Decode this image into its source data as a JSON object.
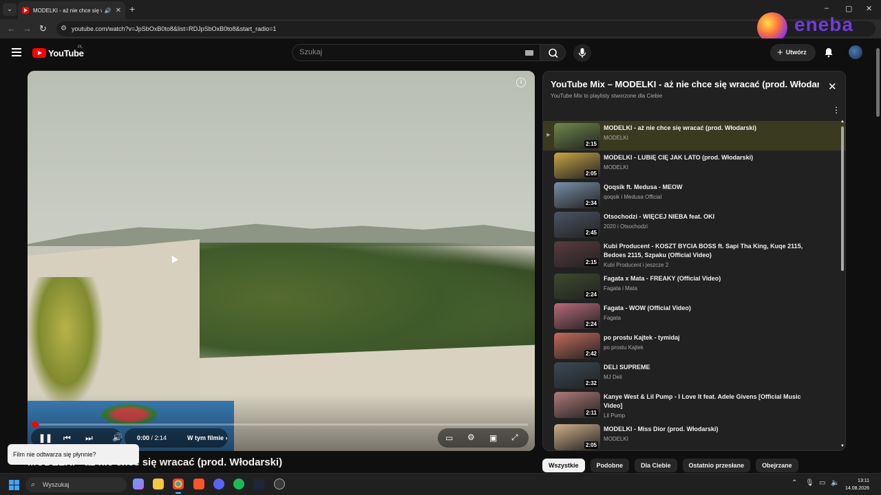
{
  "browser": {
    "tab_title": "MODELKI - aż nie chce się wracać",
    "url": "youtube.com/watch?v=JpSbOxB0to8&list=RDJpSbOxB0to8&start_radio=1",
    "new_tab": "+",
    "window_controls": [
      "–",
      "▢",
      "✕"
    ]
  },
  "watermark": {
    "text": "eneba"
  },
  "youtube": {
    "logo_text": "YouTube",
    "region": "PL",
    "search_placeholder": "Szukaj",
    "create_label": "Utwórz"
  },
  "player": {
    "time_current": "0:00",
    "time_sep": " / ",
    "time_total": "2:14",
    "chapter_label": "W tym filmie ›",
    "progress": 0.01
  },
  "toast": "Film nie odtwarza się płynnie?",
  "video_title": "MODELKI - aż nie chce się wracać (prod. Włodarski)",
  "playlist": {
    "title": "YouTube Mix – MODELKI - aż nie chce się wracać (prod. Włodar...",
    "subtitle": "YouTube Mix to playlisty stworzone dla Ciebie",
    "items": [
      {
        "title": "MODELKI - aż nie chce się wracać (prod. Włodarski)",
        "channel": "MODELKI",
        "duration": "2:15",
        "color": "#6f8a4b"
      },
      {
        "title": "MODELKI - LUBIĘ CIĘ JAK LATO (prod. Włodarski)",
        "channel": "MODELKI",
        "duration": "2:05",
        "color": "#c8a545"
      },
      {
        "title": "Qoqsik ft. Medusa - MEOW",
        "channel": "qoqsik i Medusa Official",
        "duration": "2:34",
        "color": "#7a8fa8"
      },
      {
        "title": "Otsochodzi - WIĘCEJ NIEBA feat. OKI",
        "channel": "2020 i Otsochodzi",
        "duration": "2:45",
        "color": "#4b5563"
      },
      {
        "title": "Kubi Producent - KOSZT BYCIA BOSS ft. Sapi Tha King, Kuqe 2115, Bedoes 2115, Szpaku (Official Video)",
        "channel": "Kubi Producent i jeszcze 2",
        "duration": "2:15",
        "color": "#5a3b40"
      },
      {
        "title": "Fagata x Mata - FREAKY (Official Video)",
        "channel": "Fagata i Mata",
        "duration": "2:24",
        "color": "#3e4a2e"
      },
      {
        "title": "Fagata - WOW (Official Video)",
        "channel": "Fagata",
        "duration": "2:24",
        "color": "#b86a7a"
      },
      {
        "title": "po prostu Kajtek - tymidaj",
        "channel": "po prostu Kajtek",
        "duration": "2:42",
        "color": "#c46b5a"
      },
      {
        "title": "DELI SUPREME",
        "channel": "MJ Deli",
        "duration": "2:32",
        "color": "#3a4a55"
      },
      {
        "title": "Kanye West & Lil Pump - I Love It feat. Adele Givens [Official Music Video]",
        "channel": "Lil Pump",
        "duration": "2:11",
        "color": "#b07a7a"
      },
      {
        "title": "MODELKI - Miss Dior (prod. Włodarski)",
        "channel": "MODELKI",
        "duration": "2:05",
        "color": "#d0b08a"
      }
    ]
  },
  "chips": [
    "Wszystkie",
    "Podobne",
    "Dla Ciebie",
    "Ostatnio przesłane",
    "Obejrzane"
  ],
  "taskbar": {
    "search_label": "Wyszukaj",
    "time": "13:11",
    "date": "14.08.2026"
  }
}
